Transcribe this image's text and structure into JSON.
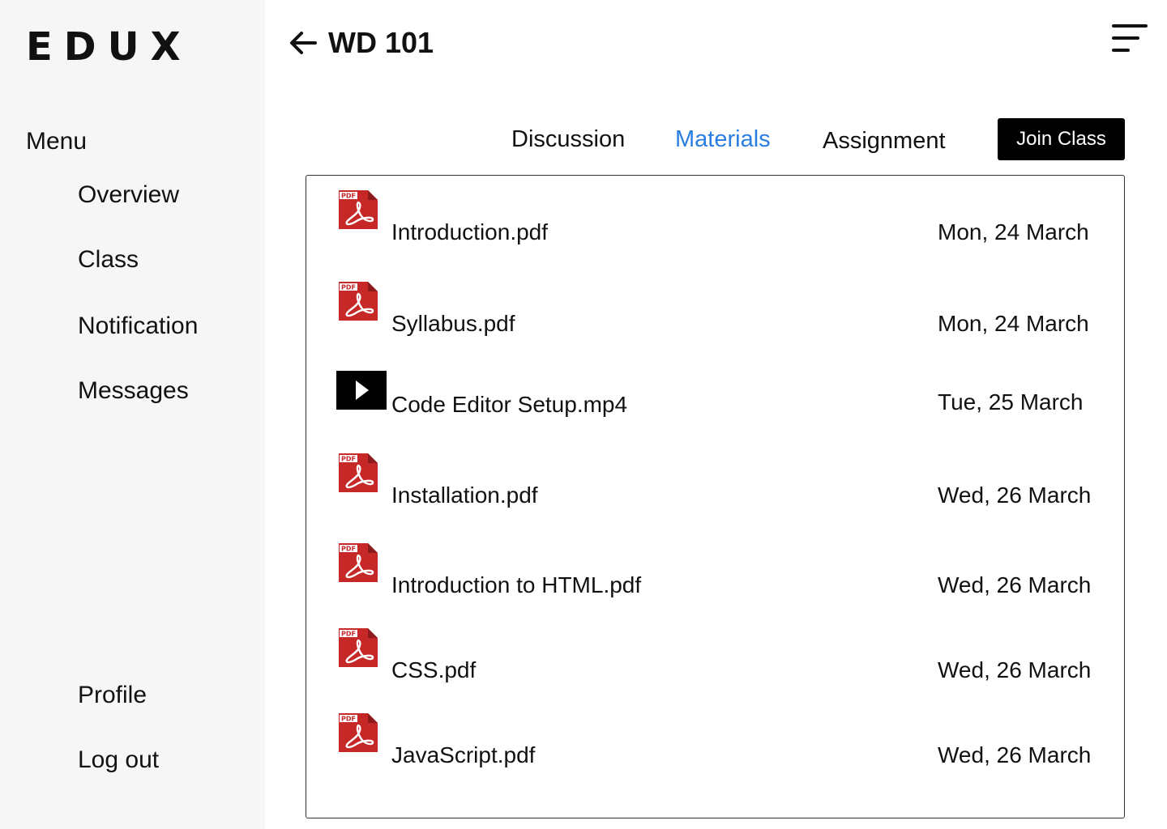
{
  "app": {
    "logo": "EDUX"
  },
  "sidebar": {
    "menu_label": "Menu",
    "items": [
      {
        "label": "Overview"
      },
      {
        "label": "Class"
      },
      {
        "label": "Notification"
      },
      {
        "label": "Messages"
      }
    ],
    "bottom_items": [
      {
        "label": "Profile"
      },
      {
        "label": "Log out"
      }
    ]
  },
  "header": {
    "title": "WD 101",
    "back_icon": "arrow-left-icon",
    "menu_icon": "hamburger-icon"
  },
  "tabs": [
    {
      "label": "Discussion",
      "active": false
    },
    {
      "label": "Materials",
      "active": true
    },
    {
      "label": "Assignment",
      "active": false
    }
  ],
  "join_button": {
    "label": "Join Class"
  },
  "colors": {
    "active_tab": "#2a7de1",
    "pdf_red": "#c62828",
    "button_bg": "#000000",
    "sidebar_bg": "#f6f6f6"
  },
  "materials": [
    {
      "icon": "pdf-icon",
      "name": "Introduction.pdf",
      "date": "Mon, 24 March"
    },
    {
      "icon": "pdf-icon",
      "name": "Syllabus.pdf",
      "date": "Mon, 24 March"
    },
    {
      "icon": "video-icon",
      "name": "Code Editor Setup.mp4",
      "date": "Tue, 25 March"
    },
    {
      "icon": "pdf-icon",
      "name": "Installation.pdf",
      "date": "Wed, 26 March"
    },
    {
      "icon": "pdf-icon",
      "name": "Introduction to HTML.pdf",
      "date": "Wed, 26 March"
    },
    {
      "icon": "pdf-icon",
      "name": "CSS.pdf",
      "date": "Wed, 26 March"
    },
    {
      "icon": "pdf-icon",
      "name": "JavaScript.pdf",
      "date": "Wed, 26 March"
    }
  ]
}
